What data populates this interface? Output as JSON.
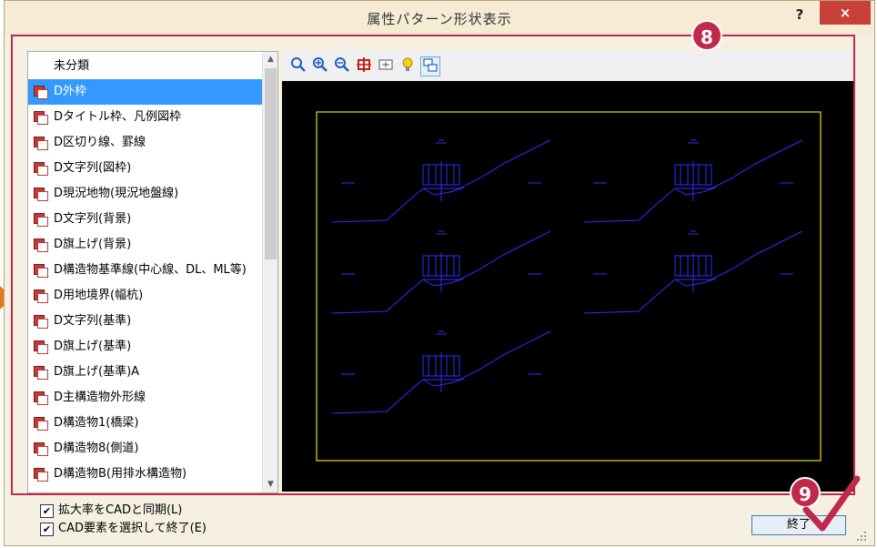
{
  "dialog": {
    "title": "属性パターン形状表示",
    "help_label": "?",
    "close_label": "×",
    "end_button": "終了"
  },
  "list": {
    "header": "未分類",
    "selected_index": 0,
    "items": [
      "D外枠",
      "Dタイトル枠、凡例図枠",
      "D区切り線、罫線",
      "D文字列(図枠)",
      "D現況地物(現況地盤線)",
      "D文字列(背景)",
      "D旗上げ(背景)",
      "D構造物基準線(中心線、DL、ML等)",
      "D用地境界(幅杭)",
      "D文字列(基準)",
      "D旗上げ(基準)",
      "D旗上げ(基準)A",
      "D主構造物外形線",
      "D構造物1(橋梁)",
      "D構造物8(側道)",
      "D構造物B(用排水構造物)"
    ]
  },
  "toolbar": {
    "icons": [
      "zoom-fit-icon",
      "zoom-in-icon",
      "zoom-out-icon",
      "pan-icon",
      "window-zoom-icon",
      "bulb-icon",
      "display-icon"
    ]
  },
  "options": {
    "sync_zoom": {
      "label": "拡大率をCADと同期(L)",
      "checked": true
    },
    "select_exit": {
      "label": "CAD要素を選択して終了(E)",
      "checked": true
    }
  },
  "annotations": {
    "badge_8": "8",
    "badge_9": "9"
  },
  "colors": {
    "annotation": "#c0294a",
    "selection": "#3399ff",
    "preview_bg": "#000000",
    "preview_frame": "#e8e000",
    "preview_lines": "#2e2eff"
  }
}
